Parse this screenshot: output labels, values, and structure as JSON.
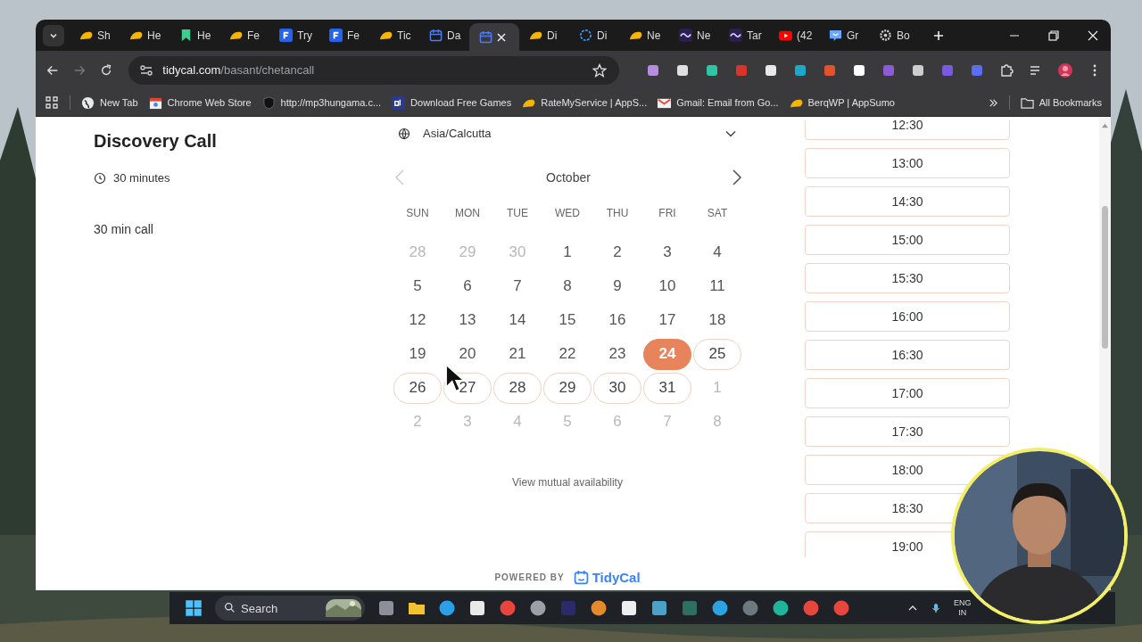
{
  "browser": {
    "tabs": [
      {
        "kind": "taco",
        "label": "Sh",
        "selected": false
      },
      {
        "kind": "taco",
        "label": "He",
        "selected": false
      },
      {
        "kind": "bookmark",
        "label": "He",
        "selected": false
      },
      {
        "kind": "taco",
        "label": "Fe",
        "selected": false
      },
      {
        "kind": "f",
        "label": "Try",
        "selected": false
      },
      {
        "kind": "f",
        "label": "Fe",
        "selected": false
      },
      {
        "kind": "taco",
        "label": "Tic",
        "selected": false
      },
      {
        "kind": "calendar",
        "label": "Da",
        "selected": false
      },
      {
        "kind": "calendar",
        "selected": true
      },
      {
        "kind": "taco",
        "label": "Di",
        "selected": false
      },
      {
        "kind": "circle",
        "label": "Di",
        "selected": false
      },
      {
        "kind": "taco",
        "label": "Ne",
        "selected": false
      },
      {
        "kind": "wave",
        "label": "Ne",
        "selected": false
      },
      {
        "kind": "wave",
        "label": "Tar",
        "selected": false
      },
      {
        "kind": "youtube",
        "label": "(42",
        "selected": false
      },
      {
        "kind": "chat",
        "label": "Gr",
        "selected": false
      },
      {
        "kind": "gear",
        "label": "Bo",
        "selected": false
      }
    ],
    "url_host": "tidycal.com",
    "url_path": "/basant/chetancall",
    "bookmarks": [
      {
        "kind": "globe",
        "label": "New Tab"
      },
      {
        "kind": "store",
        "label": "Chrome Web Store"
      },
      {
        "kind": "shield",
        "label": "http://mp3hungama.c..."
      },
      {
        "kind": "gt",
        "label": "Download Free Games"
      },
      {
        "kind": "taco",
        "label": "RateMyService | AppS..."
      },
      {
        "kind": "gmail",
        "label": "Gmail: Email from Go..."
      },
      {
        "kind": "taco",
        "label": "BerqWP | AppSumo"
      }
    ],
    "all_bookmarks": "All Bookmarks"
  },
  "event": {
    "title": "Discovery Call",
    "duration": "30 minutes",
    "description": "30 min call"
  },
  "calendar": {
    "timezone": "Asia/Calcutta",
    "month": "October",
    "weekdays": [
      "SUN",
      "MON",
      "TUE",
      "WED",
      "THU",
      "FRI",
      "SAT"
    ],
    "weeks": [
      [
        {
          "day": "28",
          "outside": true,
          "available": false,
          "selected": false
        },
        {
          "day": "29",
          "outside": true,
          "available": false,
          "selected": false
        },
        {
          "day": "30",
          "outside": true,
          "available": false,
          "selected": false
        },
        {
          "day": "1",
          "outside": false,
          "available": false,
          "selected": false
        },
        {
          "day": "2",
          "outside": false,
          "available": false,
          "selected": false
        },
        {
          "day": "3",
          "outside": false,
          "available": false,
          "selected": false
        },
        {
          "day": "4",
          "outside": false,
          "available": false,
          "selected": false
        }
      ],
      [
        {
          "day": "5",
          "outside": false,
          "available": false,
          "selected": false
        },
        {
          "day": "6",
          "outside": false,
          "available": false,
          "selected": false
        },
        {
          "day": "7",
          "outside": false,
          "available": false,
          "selected": false
        },
        {
          "day": "8",
          "outside": false,
          "available": false,
          "selected": false
        },
        {
          "day": "9",
          "outside": false,
          "available": false,
          "selected": false
        },
        {
          "day": "10",
          "outside": false,
          "available": false,
          "selected": false
        },
        {
          "day": "11",
          "outside": false,
          "available": false,
          "selected": false
        }
      ],
      [
        {
          "day": "12",
          "outside": false,
          "available": false,
          "selected": false
        },
        {
          "day": "13",
          "outside": false,
          "available": false,
          "selected": false
        },
        {
          "day": "14",
          "outside": false,
          "available": false,
          "selected": false
        },
        {
          "day": "15",
          "outside": false,
          "available": false,
          "selected": false
        },
        {
          "day": "16",
          "outside": false,
          "available": false,
          "selected": false
        },
        {
          "day": "17",
          "outside": false,
          "available": false,
          "selected": false
        },
        {
          "day": "18",
          "outside": false,
          "available": false,
          "selected": false
        }
      ],
      [
        {
          "day": "19",
          "outside": false,
          "available": false,
          "selected": false
        },
        {
          "day": "20",
          "outside": false,
          "available": false,
          "selected": false
        },
        {
          "day": "21",
          "outside": false,
          "available": false,
          "selected": false
        },
        {
          "day": "22",
          "outside": false,
          "available": false,
          "selected": false
        },
        {
          "day": "23",
          "outside": false,
          "available": false,
          "selected": false
        },
        {
          "day": "24",
          "outside": false,
          "available": true,
          "selected": true
        },
        {
          "day": "25",
          "outside": false,
          "available": true,
          "selected": false
        }
      ],
      [
        {
          "day": "26",
          "outside": false,
          "available": true,
          "selected": false
        },
        {
          "day": "27",
          "outside": false,
          "available": true,
          "selected": false
        },
        {
          "day": "28",
          "outside": false,
          "available": true,
          "selected": false
        },
        {
          "day": "29",
          "outside": false,
          "available": true,
          "selected": false
        },
        {
          "day": "30",
          "outside": false,
          "available": true,
          "selected": false
        },
        {
          "day": "31",
          "outside": false,
          "available": true,
          "selected": false
        },
        {
          "day": "1",
          "outside": true,
          "available": false,
          "selected": false
        }
      ],
      [
        {
          "day": "2",
          "outside": true,
          "available": false,
          "selected": false
        },
        {
          "day": "3",
          "outside": true,
          "available": false,
          "selected": false
        },
        {
          "day": "4",
          "outside": true,
          "available": false,
          "selected": false
        },
        {
          "day": "5",
          "outside": true,
          "available": false,
          "selected": false
        },
        {
          "day": "6",
          "outside": true,
          "available": false,
          "selected": false
        },
        {
          "day": "7",
          "outside": true,
          "available": false,
          "selected": false
        },
        {
          "day": "8",
          "outside": true,
          "available": false,
          "selected": false
        }
      ]
    ],
    "mutual_link": "View mutual availability"
  },
  "time_slots": [
    "12:30",
    "13:00",
    "14:30",
    "15:00",
    "15:30",
    "16:00",
    "16:30",
    "17:00",
    "17:30",
    "18:00",
    "18:30",
    "19:00"
  ],
  "powered_by": {
    "label": "POWERED BY",
    "brand": "TidyCal"
  },
  "taskbar": {
    "search_placeholder": "Search",
    "language": "ENG",
    "region": "IN"
  }
}
